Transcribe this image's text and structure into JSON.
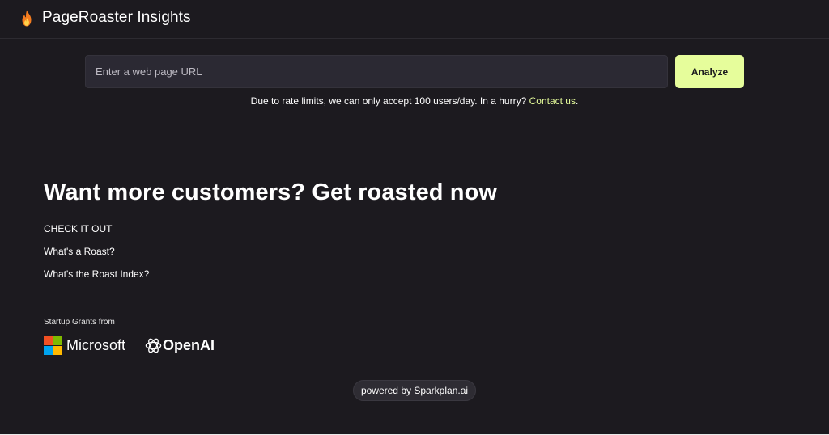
{
  "header": {
    "title": "PageRoaster Insights",
    "logo_icon": "flame-icon"
  },
  "search": {
    "placeholder": "Enter a web page URL",
    "value": "",
    "button_label": "Analyze"
  },
  "notice": {
    "text": "Due to rate limits, we can only accept 100 users/day. In a hurry? ",
    "link_label": "Contact us",
    "suffix": "."
  },
  "hero": {
    "headline": "Want more customers? Get roasted now",
    "links": [
      {
        "label": "CHECK IT OUT"
      },
      {
        "label": "What's a Roast?"
      },
      {
        "label": "What's the Roast Index?"
      }
    ]
  },
  "grants": {
    "label": "Startup Grants from",
    "sponsors": [
      {
        "name": "Microsoft",
        "icon": "microsoft-logo-icon"
      },
      {
        "name": "OpenAI",
        "icon": "openai-logo-icon"
      }
    ]
  },
  "footer": {
    "powered_by": "powered by Sparkplan.ai"
  },
  "colors": {
    "background": "#1c1a1f",
    "accent": "#e6fd9b",
    "input_bg": "#2b2933",
    "flame_outer": "#f57c1f",
    "flame_inner": "#ffd24a"
  }
}
